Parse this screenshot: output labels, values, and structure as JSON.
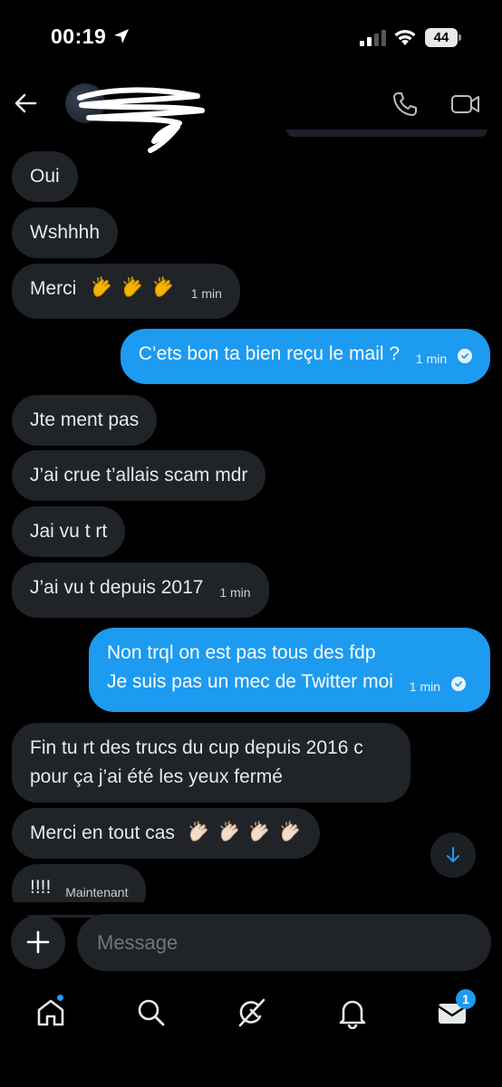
{
  "status_bar": {
    "time": "00:19",
    "battery_level": "44",
    "icons": [
      "location-arrow-icon",
      "signal-icon",
      "wifi-icon",
      "battery-icon"
    ]
  },
  "header": {
    "icons": [
      "back-arrow-icon",
      "avatar",
      "phone-icon",
      "video-icon"
    ]
  },
  "messages": [
    {
      "dir": "in",
      "text": "Oui"
    },
    {
      "dir": "in",
      "text": "Wshhhh"
    },
    {
      "dir": "in",
      "text": "Merci",
      "emoji": [
        "clapping-hands-emoji",
        "clapping-hands-emoji",
        "clapping-hands-emoji"
      ],
      "time": "1 min"
    },
    {
      "dir": "out",
      "text": "C’ets bon ta bien reçu le mail ?",
      "time": "1 min",
      "seen": true
    },
    {
      "dir": "in",
      "text": "Jte ment pas"
    },
    {
      "dir": "in",
      "text": "J’ai crue t’allais scam mdr"
    },
    {
      "dir": "in",
      "text": "Jai vu t rt"
    },
    {
      "dir": "in",
      "text": "J’ai vu t depuis 2017",
      "time": "1 min"
    },
    {
      "dir": "out",
      "lines": [
        "Non trql on est pas tous des fdp",
        "Je suis pas un mec de Twitter moi"
      ],
      "time": "1 min",
      "seen": true
    },
    {
      "dir": "in",
      "lines": [
        "Fin tu rt des trucs du cup depuis 2016 c",
        "pour ça j’ai été les yeux fermé"
      ]
    },
    {
      "dir": "in",
      "text": "Merci en tout cas",
      "emoji": [
        "clapping-hands-light-emoji",
        "clapping-hands-light-emoji",
        "clapping-hands-light-emoji",
        "clapping-hands-light-emoji"
      ]
    },
    {
      "dir": "in",
      "text": "!!!!",
      "time": "Maintenant"
    }
  ],
  "composer": {
    "placeholder": "Message"
  },
  "bottom_nav": {
    "items": [
      "home-icon",
      "search-icon",
      "grok-icon",
      "notifications-icon",
      "messages-icon"
    ],
    "messages_badge": "1"
  },
  "colors": {
    "background": "#000000",
    "incoming_bubble": "#202327",
    "outgoing_bubble": "#1d9bf0",
    "accent": "#1d9bf0"
  }
}
